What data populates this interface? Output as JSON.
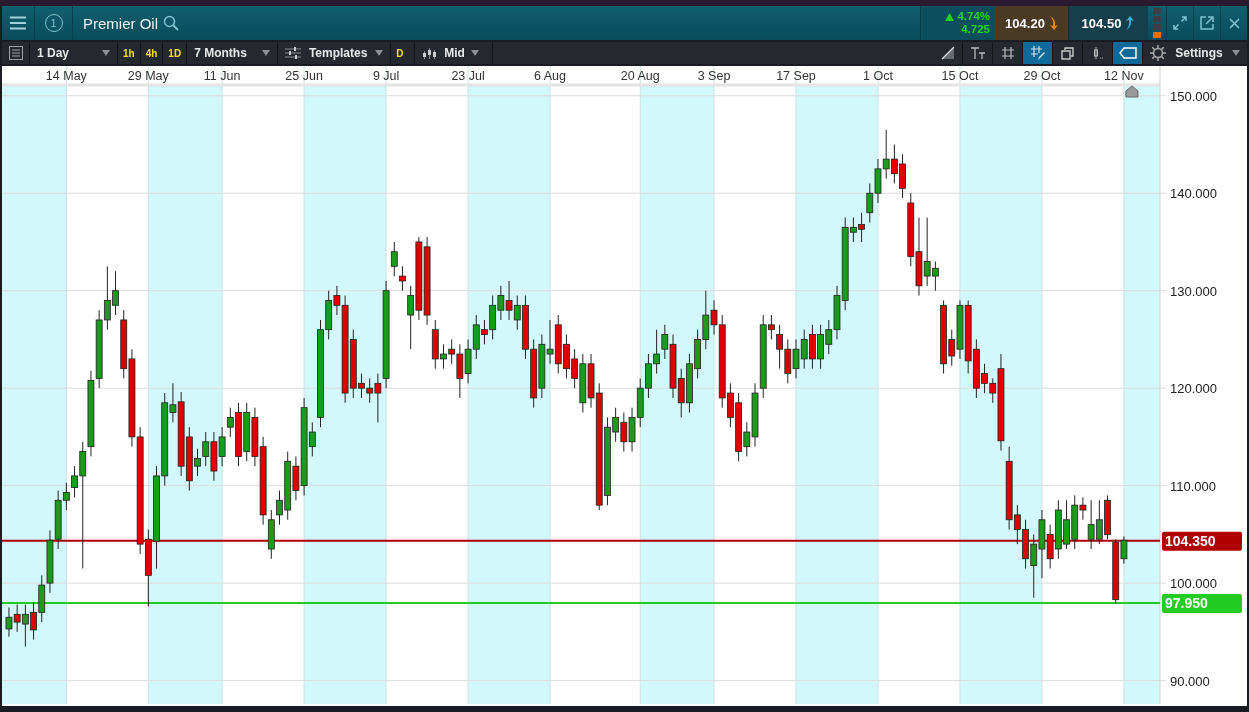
{
  "header": {
    "badge": "1",
    "instrument": "Premier Oil"
  },
  "quote": {
    "change_percent": "4.74%",
    "change": "4.725",
    "sell": "104.20",
    "buy": "104.50"
  },
  "toolbar": {
    "period": "1 Day",
    "intervals": [
      {
        "label": "1h"
      },
      {
        "label": "4h"
      },
      {
        "label": "1D"
      }
    ],
    "range": "7 Months",
    "templates": "Templates",
    "day_button": "D",
    "price_type": "Mid",
    "tools": [
      {
        "kind": "trendline",
        "selected": false
      },
      {
        "kind": "text",
        "selected": false
      },
      {
        "kind": "grid",
        "selected": false
      },
      {
        "kind": "crosshair",
        "selected": true
      },
      {
        "kind": "layers",
        "selected": false
      },
      {
        "kind": "indicator",
        "selected": false
      },
      {
        "kind": "price_tag",
        "selected": true
      }
    ],
    "settings": "Settings"
  },
  "chart": {
    "chart_data": {
      "type": "candlestick",
      "grid": true,
      "ylim": [
        87.6,
        151
      ],
      "categories": [
        null,
        null,
        null,
        null,
        null,
        null,
        null,
        "14 May",
        null,
        null,
        null,
        null,
        null,
        null,
        null,
        null,
        null,
        "29 May",
        null,
        null,
        null,
        null,
        null,
        null,
        null,
        null,
        "11 Jun",
        null,
        null,
        null,
        null,
        null,
        null,
        null,
        null,
        null,
        "25 Jun",
        null,
        null,
        null,
        null,
        null,
        null,
        null,
        null,
        null,
        "9 Jul",
        null,
        null,
        null,
        null,
        null,
        null,
        null,
        null,
        null,
        "23 Jul",
        null,
        null,
        null,
        null,
        null,
        null,
        null,
        null,
        null,
        "6 Aug",
        null,
        null,
        null,
        null,
        null,
        null,
        null,
        null,
        null,
        null,
        "20 Aug",
        null,
        null,
        null,
        null,
        null,
        null,
        null,
        null,
        "3 Sep",
        null,
        null,
        null,
        null,
        null,
        null,
        null,
        null,
        null,
        "17 Sep",
        null,
        null,
        null,
        null,
        null,
        null,
        null,
        null,
        null,
        "1 Oct",
        null,
        null,
        null,
        null,
        null,
        null,
        null,
        null,
        null,
        "15 Oct",
        null,
        null,
        null,
        null,
        null,
        null,
        null,
        null,
        null,
        "29 Oct",
        null,
        null,
        null,
        null,
        null,
        null,
        null,
        null,
        null,
        "12 Nov"
      ],
      "yticks": [
        {
          "value": 150,
          "label": "150.000"
        },
        {
          "value": 140,
          "label": "140.000"
        },
        {
          "value": 130,
          "label": "130.000"
        },
        {
          "value": 120,
          "label": "120.000"
        },
        {
          "value": 110,
          "label": "110.000"
        },
        {
          "value": 100,
          "label": "100.000"
        },
        {
          "value": 90,
          "label": "90.000"
        }
      ],
      "ohlc": [
        [
          95.3,
          97.5,
          94.5,
          96.5
        ],
        [
          96.8,
          97.8,
          95.0,
          96.0
        ],
        [
          95.8,
          97.8,
          93.5,
          96.8
        ],
        [
          97.0,
          98.0,
          94.2,
          95.2
        ],
        [
          97.0,
          100.8,
          96.0,
          99.8
        ],
        [
          100,
          105.4,
          99,
          104.4
        ],
        [
          104.5,
          109.5,
          103.5,
          108.5
        ],
        [
          108.5,
          110.3,
          107.5,
          109.3
        ],
        [
          109.8,
          112,
          108.8,
          111
        ],
        [
          111,
          114.5,
          101.5,
          113.5
        ],
        [
          114,
          121.8,
          113,
          120.8
        ],
        [
          121,
          128,
          120,
          127
        ],
        [
          127,
          132.5,
          126,
          129
        ],
        [
          128.5,
          132,
          127.5,
          130
        ],
        [
          127,
          128,
          121,
          122
        ],
        [
          123,
          124,
          114,
          115
        ],
        [
          115,
          116,
          103,
          104
        ],
        [
          104.5,
          105.5,
          97.6,
          100.8
        ],
        [
          104.3,
          112,
          101.5,
          111
        ],
        [
          111,
          119.5,
          110,
          118.5
        ],
        [
          117.5,
          120.5,
          116.5,
          118.3
        ],
        [
          118.6,
          119.6,
          111,
          112
        ],
        [
          115,
          116,
          109.5,
          110.5
        ],
        [
          112,
          113.8,
          111,
          112.8
        ],
        [
          113,
          115.5,
          112,
          114.5
        ],
        [
          114.5,
          115.5,
          110.5,
          111.5
        ],
        [
          113,
          116,
          112,
          115
        ],
        [
          116,
          118,
          115,
          117
        ],
        [
          117.5,
          118.5,
          112,
          113
        ],
        [
          113.5,
          118.5,
          112.5,
          117.5
        ],
        [
          117,
          118,
          112,
          113
        ],
        [
          114,
          115,
          106,
          107
        ],
        [
          103.5,
          107.5,
          102.5,
          106.5
        ],
        [
          107,
          109.5,
          106,
          108.5
        ],
        [
          107.5,
          113.5,
          106.5,
          112.5
        ],
        [
          112,
          113,
          108.5,
          109.5
        ],
        [
          110,
          119,
          109,
          118
        ],
        [
          114,
          116.5,
          113,
          115.5
        ],
        [
          117,
          127,
          116,
          126
        ],
        [
          126,
          130,
          125,
          129
        ],
        [
          129.5,
          130.5,
          127.5,
          128.5
        ],
        [
          128.5,
          129.5,
          118.5,
          119.5
        ],
        [
          125,
          126,
          119,
          120
        ],
        [
          120.5,
          121.5,
          119,
          120
        ],
        [
          120,
          121,
          118.5,
          119.5
        ],
        [
          120.5,
          121.5,
          116.5,
          119.5
        ],
        [
          121,
          131,
          120,
          130
        ],
        [
          132.5,
          135,
          131.5,
          134
        ],
        [
          131.5,
          132.5,
          130,
          131
        ],
        [
          127.5,
          130.5,
          124,
          129.5
        ],
        [
          135,
          135.5,
          127,
          128
        ],
        [
          134.5,
          135.5,
          126.5,
          127.5
        ],
        [
          126,
          127,
          122,
          123
        ],
        [
          123,
          124.5,
          122,
          123.5
        ],
        [
          124,
          125,
          122.5,
          123.5
        ],
        [
          123.5,
          124.5,
          119,
          121
        ],
        [
          121.5,
          125,
          120.5,
          124
        ],
        [
          124,
          127.5,
          123,
          126.5
        ],
        [
          126,
          127,
          124.5,
          125.5
        ],
        [
          126,
          129.5,
          125,
          128.5
        ],
        [
          128,
          130.5,
          127,
          129.5
        ],
        [
          129,
          131,
          127,
          128
        ],
        [
          127,
          129.5,
          126,
          128.5
        ],
        [
          128.5,
          129.5,
          123,
          124
        ],
        [
          124,
          125,
          118,
          119
        ],
        [
          120,
          125.5,
          119,
          124.5
        ],
        [
          123.5,
          127,
          122.5,
          124
        ],
        [
          126.5,
          127.5,
          121.5,
          122.5
        ],
        [
          124.5,
          125.5,
          121,
          122
        ],
        [
          123,
          124,
          120,
          121
        ],
        [
          118.5,
          123.5,
          117.5,
          122.5
        ],
        [
          122.5,
          123.5,
          118,
          119
        ],
        [
          119.5,
          120.5,
          107.5,
          108
        ],
        [
          109,
          117,
          108,
          116
        ],
        [
          115.5,
          118,
          114.5,
          117
        ],
        [
          116.5,
          117.5,
          113.5,
          114.5
        ],
        [
          114.5,
          118,
          113.5,
          117
        ],
        [
          117,
          121,
          116,
          120
        ],
        [
          120,
          123.5,
          119,
          122.5
        ],
        [
          122.5,
          126,
          121.5,
          123.5
        ],
        [
          124,
          126.5,
          123,
          125.5
        ],
        [
          124.5,
          125.5,
          119,
          120
        ],
        [
          121,
          122,
          117,
          118.5
        ],
        [
          118.5,
          123.5,
          117.5,
          122.5
        ],
        [
          122,
          126,
          121,
          125
        ],
        [
          125,
          130,
          124,
          127.5
        ],
        [
          128,
          129,
          125.5,
          126.5
        ],
        [
          126.5,
          127.5,
          118,
          119
        ],
        [
          119.5,
          120.5,
          116,
          117
        ],
        [
          118.5,
          119.5,
          112.5,
          113.5
        ],
        [
          114,
          116.5,
          113,
          115.5
        ],
        [
          115,
          120.5,
          114,
          119.5
        ],
        [
          120,
          127.5,
          119,
          126.5
        ],
        [
          126.5,
          127.5,
          125,
          126
        ],
        [
          125.5,
          126.5,
          122,
          124
        ],
        [
          124,
          125,
          120.5,
          121.5
        ],
        [
          122,
          125,
          121,
          124
        ],
        [
          123,
          126,
          122,
          125
        ],
        [
          125.5,
          126.5,
          122,
          123
        ],
        [
          123,
          126.5,
          122,
          125.5
        ],
        [
          124.5,
          127,
          123.5,
          126
        ],
        [
          126,
          130.5,
          125,
          129.5
        ],
        [
          129,
          137.5,
          128,
          136.5
        ],
        [
          136,
          137.5,
          135,
          136.5
        ],
        [
          136.8,
          138,
          135,
          136.3
        ],
        [
          138,
          141,
          137,
          140
        ],
        [
          140,
          143.5,
          139,
          142.5
        ],
        [
          142.5,
          146.5,
          141.5,
          143.5
        ],
        [
          143.5,
          145,
          141,
          142
        ],
        [
          143,
          144,
          139.5,
          140.5
        ],
        [
          139,
          140,
          132.5,
          133.5
        ],
        [
          134,
          137.5,
          129.5,
          130.5
        ],
        [
          131.5,
          137.5,
          130.5,
          133
        ],
        [
          131.5,
          133,
          130,
          132.3
        ],
        [
          128.5,
          129,
          121.5,
          122.5
        ],
        [
          125,
          126,
          122.3,
          123.3
        ],
        [
          124,
          129,
          123,
          128.5
        ],
        [
          128.5,
          129,
          121.5,
          122.8
        ],
        [
          124,
          125,
          119,
          120
        ],
        [
          121.5,
          122.5,
          119.5,
          120.5
        ],
        [
          120.5,
          121,
          118.5,
          119.5
        ],
        [
          122,
          123.5,
          113.6,
          114.6
        ],
        [
          112.5,
          114,
          105.5,
          106.5
        ],
        [
          107,
          108,
          104,
          105.5
        ],
        [
          105.5,
          106.5,
          101.5,
          102.5
        ],
        [
          101.8,
          105,
          98.5,
          104
        ],
        [
          103.5,
          107.5,
          100.5,
          106.5
        ],
        [
          105,
          106,
          101.5,
          102.5
        ],
        [
          103.5,
          108.5,
          102.5,
          107.5
        ],
        [
          104,
          108.5,
          103.5,
          106.5
        ],
        [
          104.5,
          109,
          103.5,
          108
        ],
        [
          108,
          108.8,
          106.5,
          107.5
        ],
        [
          104.5,
          108.5,
          103.5,
          106
        ],
        [
          104.5,
          108.5,
          104,
          106.5
        ],
        [
          108.5,
          109,
          104.5,
          105
        ],
        [
          104.2,
          104.5,
          97.9,
          98.3
        ],
        [
          102.5,
          104.8,
          102,
          104.4
        ]
      ],
      "ref_lines": [
        {
          "axis": "y",
          "value": 104.35,
          "label": "104.350",
          "color": "#b00000"
        },
        {
          "axis": "y",
          "value": 97.95,
          "label": "97.950",
          "color": "#22cc22"
        }
      ]
    }
  }
}
